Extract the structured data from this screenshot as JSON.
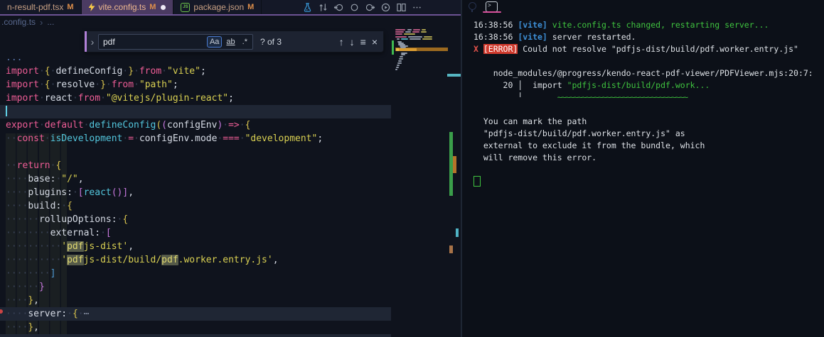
{
  "colors": {
    "accent_purple": "#6c5394",
    "active_tab": "#4b3b62",
    "find_accent": "#b180d7",
    "error_badge": "#d13b2e",
    "terminal_green": "#3fc33f",
    "vite_blue": "#3d8fd6",
    "match_highlight": "#555a49",
    "git_green": "#3fb950",
    "cursor": "#62d2e8"
  },
  "tabs": [
    {
      "label": "n-result-pdf.tsx",
      "badge": "M",
      "icon": null,
      "active": false,
      "dot": false
    },
    {
      "label": "vite.config.ts",
      "badge": "M",
      "icon": "vite-bolt",
      "active": true,
      "dot": true
    },
    {
      "label": "package.json",
      "badge": "M",
      "icon": "json",
      "active": false,
      "dot": false
    }
  ],
  "icons": {
    "json_glyph": "JS",
    "terminal_glyph": ">"
  },
  "toolbar": {
    "icons": [
      "flask-icon",
      "compare-changes-icon",
      "circle-arrow-left-icon",
      "circle-icon",
      "circle-arrow-right-icon",
      "run-circle-icon",
      "split-editor-icon",
      "more-actions-icon"
    ]
  },
  "breadcrumb": {
    "file": ".config.ts",
    "sep": "›",
    "more": "..."
  },
  "find": {
    "query": "pdf",
    "case_label": "Aa",
    "word_label": "ab",
    "regex_label": ".*",
    "results": "? of 3",
    "chevron": "›",
    "prev": "↑",
    "next": "↓",
    "selection": "≡",
    "close": "×"
  },
  "code": {
    "lines": [
      {
        "hl": false,
        "cursor": false,
        "segs": [
          [
            "cm",
            "..."
          ]
        ]
      },
      {
        "hl": false,
        "cursor": false,
        "segs": [
          [
            "kw",
            "import"
          ],
          [
            "ws",
            "·"
          ],
          [
            "b1",
            "{"
          ],
          [
            "ws",
            "·"
          ],
          [
            "fg",
            "defineConfig"
          ],
          [
            "ws",
            "·"
          ],
          [
            "b1",
            "}"
          ],
          [
            "ws",
            "·"
          ],
          [
            "kw",
            "from"
          ],
          [
            "ws",
            "·"
          ],
          [
            "str",
            "\"vite\""
          ],
          [
            "fg",
            ";"
          ]
        ]
      },
      {
        "hl": false,
        "cursor": false,
        "segs": [
          [
            "kw",
            "import"
          ],
          [
            "ws",
            "·"
          ],
          [
            "b1",
            "{"
          ],
          [
            "ws",
            "·"
          ],
          [
            "fg",
            "resolve"
          ],
          [
            "ws",
            "·"
          ],
          [
            "b1",
            "}"
          ],
          [
            "ws",
            "·"
          ],
          [
            "kw",
            "from"
          ],
          [
            "ws",
            "·"
          ],
          [
            "str",
            "\"path\""
          ],
          [
            "fg",
            ";"
          ]
        ]
      },
      {
        "hl": false,
        "cursor": false,
        "segs": [
          [
            "kw",
            "import"
          ],
          [
            "ws",
            "·"
          ],
          [
            "fg",
            "react"
          ],
          [
            "ws",
            "·"
          ],
          [
            "kw",
            "from"
          ],
          [
            "ws",
            "·"
          ],
          [
            "str",
            "\"@vitejs/plugin-react\""
          ],
          [
            "fg",
            ";"
          ]
        ]
      },
      {
        "hl": true,
        "cursor": true,
        "segs": []
      },
      {
        "hl": false,
        "cursor": false,
        "segs": [
          [
            "kw",
            "export"
          ],
          [
            "ws",
            "·"
          ],
          [
            "kw",
            "default"
          ],
          [
            "ws",
            "·"
          ],
          [
            "fn",
            "defineConfig"
          ],
          [
            "b1",
            "("
          ],
          [
            "b2",
            "("
          ],
          [
            "fg",
            "configEnv"
          ],
          [
            "b2",
            ")"
          ],
          [
            "ws",
            "·"
          ],
          [
            "kw",
            "=>"
          ],
          [
            "ws",
            "·"
          ],
          [
            "b1",
            "{"
          ]
        ]
      },
      {
        "hl": false,
        "cursor": false,
        "segs": [
          [
            "ws",
            "··"
          ],
          [
            "kw",
            "const"
          ],
          [
            "ws",
            "·"
          ],
          [
            "fn",
            "isDevelopment"
          ],
          [
            "ws",
            "·"
          ],
          [
            "kw",
            "="
          ],
          [
            "ws",
            "·"
          ],
          [
            "fg",
            "configEnv.mode"
          ],
          [
            "ws",
            "·"
          ],
          [
            "kw",
            "==="
          ],
          [
            "ws",
            "·"
          ],
          [
            "str",
            "\"development\""
          ],
          [
            "fg",
            ";"
          ]
        ]
      },
      {
        "hl": false,
        "cursor": false,
        "segs": []
      },
      {
        "hl": false,
        "cursor": false,
        "segs": [
          [
            "ws",
            "··"
          ],
          [
            "kw",
            "return"
          ],
          [
            "ws",
            "·"
          ],
          [
            "b1",
            "{"
          ]
        ]
      },
      {
        "hl": false,
        "cursor": false,
        "segs": [
          [
            "ws",
            "····"
          ],
          [
            "fg",
            "base:"
          ],
          [
            "ws",
            "·"
          ],
          [
            "str",
            "\"/\""
          ],
          [
            "fg",
            ","
          ]
        ]
      },
      {
        "hl": false,
        "cursor": false,
        "segs": [
          [
            "ws",
            "····"
          ],
          [
            "fg",
            "plugins:"
          ],
          [
            "ws",
            "·"
          ],
          [
            "b2",
            "["
          ],
          [
            "fn",
            "react"
          ],
          [
            "b2",
            "()"
          ],
          [
            "b2",
            "]"
          ],
          [
            "fg",
            ","
          ]
        ]
      },
      {
        "hl": false,
        "cursor": false,
        "segs": [
          [
            "ws",
            "····"
          ],
          [
            "fg",
            "build:"
          ],
          [
            "ws",
            "·"
          ],
          [
            "b1",
            "{"
          ]
        ]
      },
      {
        "hl": false,
        "cursor": false,
        "segs": [
          [
            "ws",
            "······"
          ],
          [
            "fg",
            "rollupOptions:"
          ],
          [
            "ws",
            "·"
          ],
          [
            "b1",
            "{"
          ]
        ]
      },
      {
        "hl": false,
        "cursor": false,
        "segs": [
          [
            "ws",
            "········"
          ],
          [
            "fg",
            "external:"
          ],
          [
            "ws",
            "·"
          ],
          [
            "b2",
            "["
          ]
        ]
      },
      {
        "hl": false,
        "cursor": false,
        "segs": [
          [
            "ws",
            "··········"
          ],
          [
            "str",
            "'"
          ],
          [
            "strm",
            "pdf"
          ],
          [
            "str",
            "js-dist'"
          ],
          [
            "fg",
            ","
          ]
        ]
      },
      {
        "hl": false,
        "cursor": false,
        "segs": [
          [
            "ws",
            "··········"
          ],
          [
            "str",
            "'"
          ],
          [
            "strm",
            "pdf"
          ],
          [
            "str",
            "js-dist/build/"
          ],
          [
            "strm",
            "pdf"
          ],
          [
            "str",
            ".worker.entry.js'"
          ],
          [
            "fg",
            ","
          ]
        ]
      },
      {
        "hl": false,
        "cursor": false,
        "segs": [
          [
            "ws",
            "········"
          ],
          [
            "b3",
            "]"
          ]
        ]
      },
      {
        "hl": false,
        "cursor": false,
        "segs": [
          [
            "ws",
            "······"
          ],
          [
            "b2",
            "}"
          ]
        ]
      },
      {
        "hl": false,
        "cursor": false,
        "segs": [
          [
            "ws",
            "····"
          ],
          [
            "b1",
            "}"
          ],
          [
            "fg",
            ","
          ]
        ]
      },
      {
        "hl": true,
        "cursor": false,
        "segs": [
          [
            "ws",
            "····"
          ],
          [
            "fg",
            "server:"
          ],
          [
            "ws",
            "·"
          ],
          [
            "b1",
            "{"
          ],
          [
            "ws",
            "·"
          ],
          [
            "fold",
            "⋯"
          ]
        ]
      },
      {
        "hl": false,
        "cursor": false,
        "segs": [
          [
            "ws",
            "····"
          ],
          [
            "b1",
            "}"
          ],
          [
            "fg",
            ","
          ]
        ]
      }
    ]
  },
  "minimap": {
    "rows": [
      [
        1,
        3,
        14,
        "p"
      ],
      [
        1,
        20,
        6,
        "w"
      ],
      [
        1,
        28,
        10,
        "p"
      ],
      [
        1,
        40,
        6,
        "y"
      ],
      [
        4,
        3,
        12,
        "p"
      ],
      [
        4,
        17,
        8,
        "w"
      ],
      [
        4,
        27,
        10,
        "p"
      ],
      [
        4,
        39,
        8,
        "y"
      ],
      [
        7,
        3,
        10,
        "p"
      ],
      [
        7,
        15,
        16,
        "y"
      ],
      [
        11,
        3,
        16,
        "p"
      ],
      [
        11,
        21,
        20,
        "w"
      ],
      [
        11,
        43,
        12,
        "y"
      ],
      [
        14,
        5,
        4,
        "w"
      ],
      [
        14,
        11,
        10,
        "t"
      ],
      [
        14,
        23,
        16,
        "w"
      ],
      [
        14,
        41,
        14,
        "y"
      ],
      [
        18,
        6,
        6,
        "w"
      ],
      [
        20,
        7,
        8,
        "w"
      ],
      [
        22,
        7,
        10,
        "w"
      ],
      [
        24,
        9,
        12,
        "w"
      ],
      [
        26,
        10,
        8,
        "w"
      ],
      [
        34,
        11,
        9,
        "w"
      ],
      [
        36,
        11,
        6,
        "w"
      ],
      [
        39,
        9,
        5,
        "w"
      ],
      [
        42,
        8,
        6,
        "w"
      ],
      [
        45,
        7,
        5,
        "w"
      ],
      [
        48,
        6,
        6,
        "w"
      ],
      [
        51,
        5,
        4,
        "w"
      ],
      [
        54,
        4,
        4,
        "w"
      ],
      [
        57,
        3,
        3,
        "w"
      ]
    ]
  },
  "ruler": {
    "markers": [
      [
        1,
        104,
        19,
        4,
        "#56b6c2"
      ],
      [
        4,
        186,
        5,
        90,
        "#3a9e4a"
      ],
      [
        9,
        220,
        5,
        24,
        "#b5742a"
      ],
      [
        13,
        322,
        4,
        12,
        "#4fb3c4"
      ],
      [
        4,
        346,
        5,
        11,
        "#a87348"
      ]
    ]
  },
  "terminal": {
    "lines": [
      {
        "segs": [
          [
            "w",
            "16:38:56 "
          ],
          [
            "bl",
            "[vite]"
          ],
          [
            "g",
            " vite.config.ts changed, restarting server..."
          ]
        ]
      },
      {
        "segs": [
          [
            "w",
            "16:38:56 "
          ],
          [
            "bl",
            "[vite]"
          ],
          [
            "w",
            " server restarted."
          ]
        ]
      },
      {
        "segs": [
          [
            "rx",
            "X "
          ],
          [
            "eb",
            "[ERROR]"
          ],
          [
            "w",
            " Could not resolve \"pdfjs-dist/build/pdf.worker.entry.js\""
          ]
        ]
      },
      {
        "segs": []
      },
      {
        "segs": [
          [
            "w",
            "    node_modules/@progress/kendo-react-pdf-viewer/PDFViewer.mjs:20:7:"
          ]
        ]
      },
      {
        "segs": [
          [
            "w",
            "      20 │  import "
          ],
          [
            "g",
            "\"pdfjs-dist/build/pdf.work..."
          ]
        ]
      },
      {
        "segs": [
          [
            "w",
            "         ╵       "
          ],
          [
            "sq",
            "~~~~~~~~~~~~~~~~~~~~~~~~~~~~~~~~"
          ]
        ]
      },
      {
        "segs": []
      },
      {
        "segs": [
          [
            "w",
            "  You can mark the path"
          ]
        ]
      },
      {
        "segs": [
          [
            "w",
            "  \"pdfjs-dist/build/pdf.worker.entry.js\" as"
          ]
        ]
      },
      {
        "segs": [
          [
            "w",
            "  external to exclude it from the bundle, which"
          ]
        ]
      },
      {
        "segs": [
          [
            "w",
            "  will remove this error."
          ]
        ]
      },
      {
        "segs": []
      },
      {
        "segs": [
          [
            "cur",
            " "
          ]
        ]
      }
    ]
  }
}
